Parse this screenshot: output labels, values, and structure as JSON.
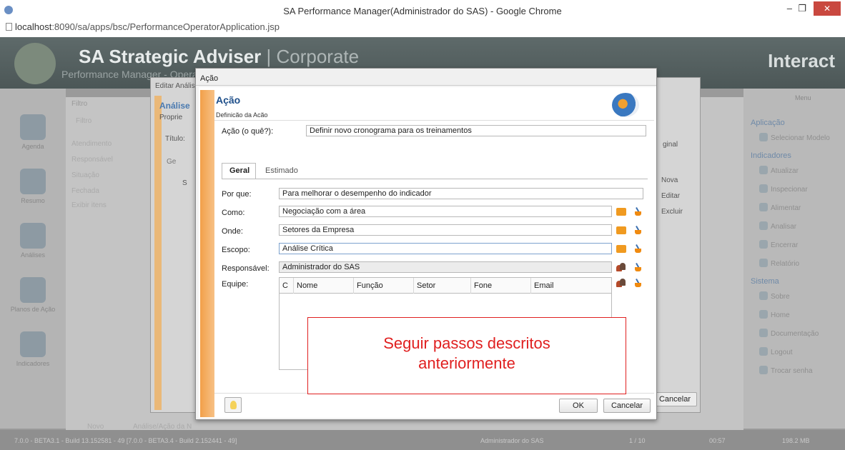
{
  "browser": {
    "window_title": "SA Performance Manager(Administrador do SAS) - Google Chrome",
    "url_host": "localhost",
    "url_path": ":8090/sa/apps/bsc/PerformanceOperatorApplication.jsp",
    "close_glyph": "✕",
    "minimize_glyph": "–",
    "restore_glyph": "❐"
  },
  "app": {
    "brand_main": "SA Strategic Adviser",
    "brand_sep": " | ",
    "brand_edition": "Corporate",
    "subtitle": "Performance Manager - Opera",
    "vendor": "Interact",
    "rail": [
      "Agenda",
      "Resumo",
      "Análises",
      "Planos de Ação",
      "Indicadores"
    ],
    "menu_title": "Menu",
    "menu_sections": [
      {
        "title": "Aplicação",
        "items": [
          "Selecionar Modelo"
        ]
      },
      {
        "title": "Indicadores",
        "items": [
          "Atualizar",
          "Inspecionar",
          "Alimentar",
          "Analisar",
          "Encerrar",
          "Relatório"
        ]
      },
      {
        "title": "Sistema",
        "items": [
          "Sobre",
          "Home",
          "Documentação",
          "Logout",
          "Trocar senha"
        ]
      }
    ],
    "status": {
      "build": "7.0.0 - BETA3.1 - Build 13.152581 - 49 [7.0.0 - BETA3.4 - Build 2.152441 - 49]",
      "user": "Administrador do SAS",
      "page": "1 / 10",
      "time": "00:57",
      "memory": "198.2 MB"
    },
    "bg_labels": {
      "filter": "Filtro",
      "filter2": "Filtro",
      "rows": [
        "Atendimento",
        "Responsável",
        "Situação",
        "Fechada",
        "Exibir itens"
      ],
      "new": "Novo",
      "analysis": "Análise/Ação da N"
    }
  },
  "parent_dialog": {
    "title": "Editar Análise",
    "heading": "Análise",
    "sub": "Proprie",
    "titulo_label": "Título:",
    "tab": "Ge",
    "col": "S",
    "side_original": "ginal",
    "actions": [
      "Nova",
      "Editar",
      "Excluir"
    ],
    "cancel": "Cancelar",
    "registros": "Registros"
  },
  "dialog": {
    "window_title": "Ação",
    "heading": "Ação",
    "subheading": "Definição da Ação",
    "action_label": "Ação (o quê?):",
    "action_value": "Definir novo cronograma para os treinamentos",
    "tabs": [
      "Geral",
      "Estimado"
    ],
    "active_tab": "Geral",
    "fields": [
      {
        "label": "Por que:",
        "value": "Para melhorar o desempenho do indicador"
      },
      {
        "label": "Como:",
        "value": "Negociação com a área"
      },
      {
        "label": "Onde:",
        "value": "Setores da Empresa"
      },
      {
        "label": "Escopo:",
        "value": "Análise Crítica"
      },
      {
        "label": "Responsável:",
        "value": "Administrador do SAS"
      }
    ],
    "team_label": "Equipe:",
    "team_columns": [
      "C",
      "Nome",
      "Função",
      "Setor",
      "Fone",
      "Email"
    ],
    "ok": "OK",
    "cancel": "Cancelar"
  },
  "annotation": {
    "line1": "Seguir passos descritos",
    "line2": "anteriormente",
    "color": "#e02020"
  }
}
